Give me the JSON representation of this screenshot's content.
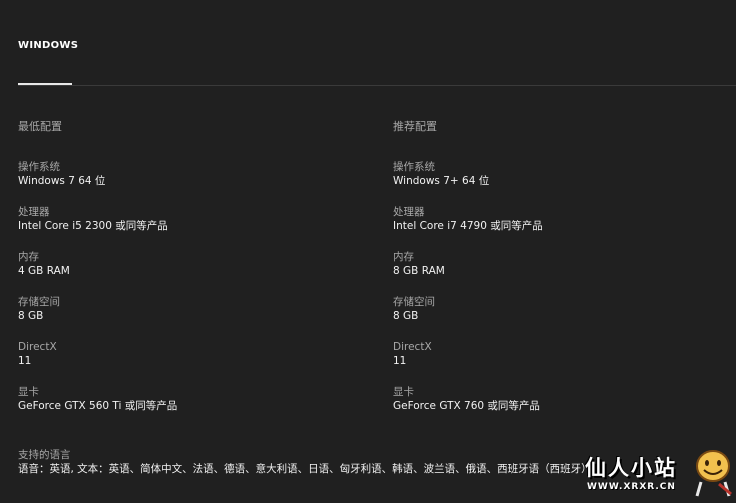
{
  "tabs": [
    {
      "label": "WINDOWS",
      "active": true
    }
  ],
  "requirements": {
    "minimum": {
      "title": "最低配置",
      "specs": [
        {
          "label": "操作系统",
          "value": "Windows 7 64 位"
        },
        {
          "label": "处理器",
          "value": "Intel Core i5 2300 或同等产品"
        },
        {
          "label": "内存",
          "value": "4 GB RAM"
        },
        {
          "label": "存储空间",
          "value": "8 GB"
        },
        {
          "label": "DirectX",
          "value": "11"
        },
        {
          "label": "显卡",
          "value": "GeForce GTX 560 Ti 或同等产品"
        }
      ]
    },
    "recommended": {
      "title": "推荐配置",
      "specs": [
        {
          "label": "操作系统",
          "value": "Windows 7+ 64 位"
        },
        {
          "label": "处理器",
          "value": "Intel Core i7 4790 或同等产品"
        },
        {
          "label": "内存",
          "value": "8 GB RAM"
        },
        {
          "label": "存储空间",
          "value": "8 GB"
        },
        {
          "label": "DirectX",
          "value": "11"
        },
        {
          "label": "显卡",
          "value": "GeForce GTX 760 或同等产品"
        }
      ]
    }
  },
  "languages": {
    "label": "支持的语言",
    "value": "语音：英语, 文本：英语、简体中文、法语、德语、意大利语、日语、匈牙利语、韩语、波兰语、俄语、西班牙语（西班牙）"
  },
  "watermark": {
    "name": "仙人小站",
    "url": "WWW.XRXR.CN",
    "icon": "smiley-face-icon"
  }
}
